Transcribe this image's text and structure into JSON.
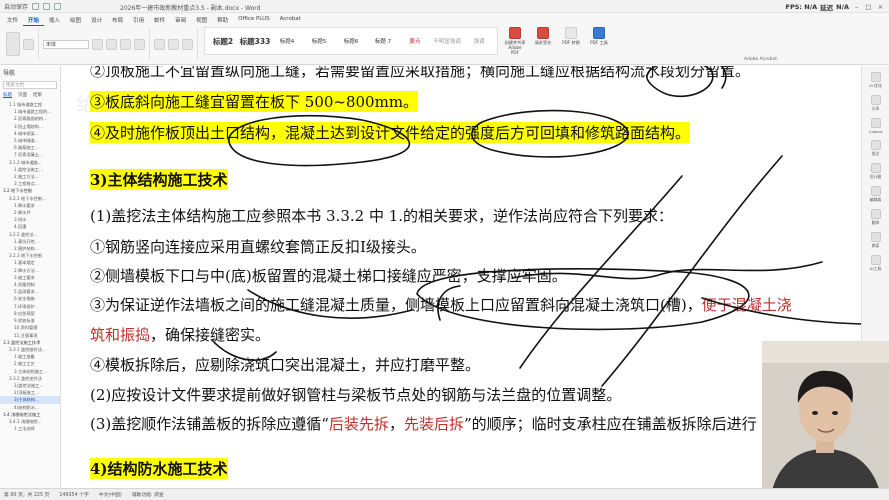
{
  "titlebar": {
    "autosave": "自动保存",
    "doc_title": "2026年一建市政新教材重点3.5 - 副本.docx - Word",
    "fps": "FPS: N/A",
    "latency_label": "延迟",
    "latency": "N/A"
  },
  "ribbon": {
    "tabs": [
      "文件",
      "开始",
      "插入",
      "绘图",
      "设计",
      "布局",
      "引用",
      "邮件",
      "审阅",
      "视图",
      "帮助",
      "Office PLUS",
      "Acrobat"
    ],
    "active_tab": "开始",
    "font_name": "宋体",
    "styles": [
      {
        "label": "标题2",
        "cls": "big"
      },
      {
        "label": "标题333",
        "cls": "big"
      },
      {
        "label": "标题4",
        "cls": ""
      },
      {
        "label": "标题5",
        "cls": ""
      },
      {
        "label": "标题6",
        "cls": ""
      },
      {
        "label": "标题 7",
        "cls": ""
      },
      {
        "label": "要点",
        "cls": "pink"
      },
      {
        "label": "不明显强调",
        "cls": "faint"
      },
      {
        "label": "强调",
        "cls": "faint"
      }
    ],
    "right_tools": [
      {
        "label": "创建并共享 Adobe PDF",
        "color": "red"
      },
      {
        "label": "请求签名",
        "color": "red"
      },
      {
        "label": "PDF 转换",
        "color": ""
      },
      {
        "label": "PDF 工具",
        "color": "blue"
      }
    ],
    "acrobat_label": "Adobe Acrobat"
  },
  "nav": {
    "title": "导航",
    "search_placeholder": "搜索文档",
    "tabs": [
      "标题",
      "页面",
      "结果"
    ],
    "items": [
      {
        "text": "1.1 城市道路工程",
        "level": "l2"
      },
      {
        "text": "1.城市道路工程的…",
        "level": "l3"
      },
      {
        "text": "2.沥青路面结构…",
        "level": "l3"
      },
      {
        "text": "3.挡土墙结构…",
        "level": "l3"
      },
      {
        "text": "4.城市桥梁…",
        "level": "l3"
      },
      {
        "text": "5.城市隧道…",
        "level": "l3"
      },
      {
        "text": "6.路基施工…",
        "level": "l3"
      },
      {
        "text": "7.沥青混凝土…",
        "level": "l3"
      },
      {
        "text": "3.1.2 城市道路…",
        "level": "l2"
      },
      {
        "text": "1.盖挖法施工…",
        "level": "l3"
      },
      {
        "text": "2.施工方法…",
        "level": "l3"
      },
      {
        "text": "3.工程难点…",
        "level": "l3"
      },
      {
        "text": "3.2 地下水控制",
        "level": "l1"
      },
      {
        "text": "3.2.1 地下水控制…",
        "level": "l2"
      },
      {
        "text": "1.降水要求",
        "level": "l3"
      },
      {
        "text": "2.降水井",
        "level": "l3"
      },
      {
        "text": "3.排水",
        "level": "l3"
      },
      {
        "text": "4.回灌",
        "level": "l3"
      },
      {
        "text": "3.2.2 盖挖法…",
        "level": "l2"
      },
      {
        "text": "1.基坑开挖…",
        "level": "l3"
      },
      {
        "text": "2.围护结构…",
        "level": "l3"
      },
      {
        "text": "3.2.3 地下水控制",
        "level": "l2"
      },
      {
        "text": "1.基本规定",
        "level": "l3"
      },
      {
        "text": "2.降水方法…",
        "level": "l3"
      },
      {
        "text": "3.施工要求",
        "level": "l3"
      },
      {
        "text": "4.质量控制",
        "level": "l3"
      },
      {
        "text": "5.监测要求…",
        "level": "l3"
      },
      {
        "text": "6.安全措施",
        "level": "l3"
      },
      {
        "text": "7.环境保护",
        "level": "l3"
      },
      {
        "text": "8.应急预案",
        "level": "l3"
      },
      {
        "text": "9.验收标准",
        "level": "l3"
      },
      {
        "text": "10.资料管理",
        "level": "l3"
      },
      {
        "text": "11.注意事项",
        "level": "l3"
      },
      {
        "text": "3.3 盖挖法施工技术",
        "level": "l1"
      },
      {
        "text": "3.3.1 盖挖顺作法…",
        "level": "l2"
      },
      {
        "text": "1.施工准备",
        "level": "l3"
      },
      {
        "text": "2.施工工艺",
        "level": "l3"
      },
      {
        "text": "3.主体结构施工…",
        "level": "l3"
      },
      {
        "text": "3.3.2 盖挖逆作法",
        "level": "l2"
      },
      {
        "text": "1)盖挖法施工…",
        "level": "l3"
      },
      {
        "text": "2)顶板施工…",
        "level": "l3"
      },
      {
        "text": "3)主体结构…",
        "level": "l3",
        "sel": true
      },
      {
        "text": "4)结构防水…",
        "level": "l3"
      },
      {
        "text": "3.4 浅埋暗挖法施工",
        "level": "l1"
      },
      {
        "text": "3.4.1 浅埋暗挖…",
        "level": "l2"
      },
      {
        "text": "1.工法选择",
        "level": "l3"
      }
    ]
  },
  "document": {
    "watermark": "给亮老师",
    "line1": "②顶板施工不宜留置纵向施工缝，若需要留置应采取措施；横向施工缝应根据结构流水段划分留置。",
    "line2": "③板底斜向施工缝宜留置在板下 500~800mm。",
    "line3": "④及时施作板顶出土口结构，混凝土达到设计文件给定的强度后方可回填和修筑路面结构。",
    "heading": "3)主体结构施工技术",
    "line4": "(1)盖挖法主体结构施工应参照本书 3.3.2 中 1.的相关要求，逆作法尚应符合下列要求：",
    "line5": "①钢筋竖向连接应采用直螺纹套筒正反扣Ⅰ级接头。",
    "line6": "②侧墙模板下口与中(底)板留置的混凝土梯口接缝应严密，支撑应牢固。",
    "line7_black": "③为保证逆作法墙板之间的施工缝混凝土质量，侧墙模板上口应留置斜向混凝土浇筑口(槽)，",
    "line7_red": "便于混凝土浇",
    "line8_red": "筑和振捣",
    "line8_black": "，确保接缝密实。",
    "line9": "④模板拆除后，应剔除浇筑口突出混凝土，并应打磨平整。",
    "line10": "(2)应按设计文件要求提前做好钢管柱与梁板节点处的钢筋与法兰盘的位置调整。",
    "line11_a": "(3)盖挖顺作法铺盖板的拆除应遵循“",
    "line11_red1": "后装先拆",
    "line11_b": "，",
    "line11_red2": "先装后拆",
    "line11_c": "”的顺序；临时支承柱应在铺盖板拆除后进行",
    "line12": "4)结构防水施工技术"
  },
  "side": {
    "items": [
      "AI 优化",
      "分享",
      "Copilot",
      "批注",
      "设计器",
      "编辑器",
      "翻译",
      "朗读",
      "AI工具"
    ]
  },
  "status": {
    "page": "第 60 页，共 225 页",
    "words": "149354 个字",
    "lang": "中文(中国)",
    "access": "辅助功能: 调查"
  }
}
